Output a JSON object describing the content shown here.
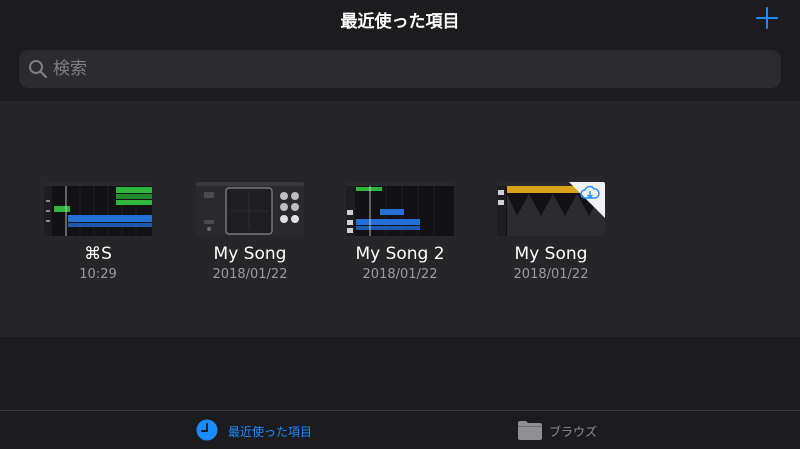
{
  "header": {
    "title": "最近使った項目"
  },
  "search": {
    "placeholder": "検索"
  },
  "documents": [
    {
      "name": "⌘S",
      "date": "10:29"
    },
    {
      "name": "My Song",
      "date": "2018/01/22"
    },
    {
      "name": "My Song 2",
      "date": "2018/01/22"
    },
    {
      "name": "My Song",
      "date": "2018/01/22"
    }
  ],
  "tabs": [
    {
      "label": "最近使った項目"
    },
    {
      "label": "ブラウズ"
    }
  ],
  "colors": {
    "accent": "#1a8cff",
    "background": "#1c1c1e",
    "content": "#262628"
  }
}
